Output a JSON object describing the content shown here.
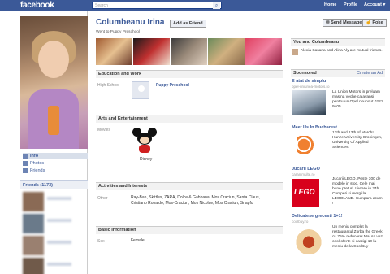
{
  "topbar": {
    "logo": "facebook",
    "search_placeholder": "Search",
    "nav": [
      "Home",
      "Profile",
      "Account ▾"
    ]
  },
  "profile": {
    "name": "Columbeanu Irina",
    "add_friend": "Add as Friend",
    "send_message": "Send Message",
    "poke": "Poke",
    "status": "Went to Puppy Preschool"
  },
  "sidebar": {
    "links": [
      "Info",
      "Photos",
      "Friends"
    ],
    "friends_header": "Friends (1173)"
  },
  "sections": {
    "education": {
      "title": "Education and Work",
      "label": "High School",
      "value": "Puppy Preschool"
    },
    "arts": {
      "title": "Arts and Entertainment",
      "label": "Movies",
      "value": "Disney"
    },
    "activities": {
      "title": "Activities and Interests",
      "label": "Other",
      "value": "Ray-Ban, Skittles, ZARA, Dolce & Gabbana, Mos Craciun, Santa Claus, Cristiano Ronaldo, Mos-Craciun, Mos Nicolae, Mos Craciun, Snapfu"
    },
    "basic": {
      "title": "Basic Information",
      "label": "Sex",
      "value": "Female"
    }
  },
  "right": {
    "mutual_title": "You and Columbeanu",
    "mutual_text": "Alexia Sasana and Alina Aly are mutual friends.",
    "sponsored": "Sponsored",
    "create_ad": "Create an Ad",
    "ads": [
      {
        "title": "E atat de simplu",
        "url": "opel-uniunea-motors.ro",
        "text": "La Union Motors in preluam masina veche ca avansi pentru un Opel nounout 0221 9405"
      },
      {
        "title": "Meet Us In Bucharest",
        "url": "",
        "text": "12th and 13th of March! Hanze University Groningen, University Of Applied Sciences"
      },
      {
        "title": "Jucarii LEGO",
        "url": "caranimulte.ro",
        "text": "Jucarii LEGO. Peste 300 de modele in stoc. Cele mai bune preturi. Livrare in 24h. Cumperi si mergi la LEGOLAND. Cumpara acum !"
      },
      {
        "title": "Delicatese grecesti 1+1!",
        "url": "coolbuy.ro",
        "text": "Un meniu complet la restaurantul Zorba the Greek cu 75% reducere! Mai sa vezi cool-oferte si castigi 10 la meniu de la CoolBuy"
      }
    ]
  }
}
